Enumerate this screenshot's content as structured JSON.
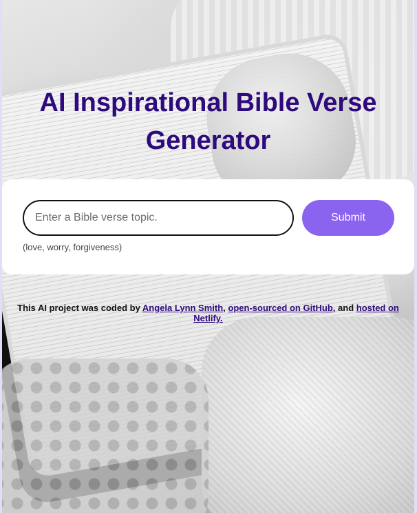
{
  "page": {
    "title_line1": "AI Inspirational Bible Verse",
    "title_line2": "Generator"
  },
  "form": {
    "input_placeholder": "Enter a Bible verse topic.",
    "input_value": "",
    "submit_label": "Submit",
    "hint": "(love, worry, forgiveness)"
  },
  "footer": {
    "prefix": "This AI project was coded by ",
    "author_link": "Angela Lynn Smith",
    "sep1": ", ",
    "github_link": "open-sourced on GitHub",
    "sep2": ", and ",
    "netlify_link": "hosted on Netlify."
  },
  "colors": {
    "title": "#2e0a7d",
    "button": "#8a63ef",
    "page_border": "#e6dcf7"
  }
}
